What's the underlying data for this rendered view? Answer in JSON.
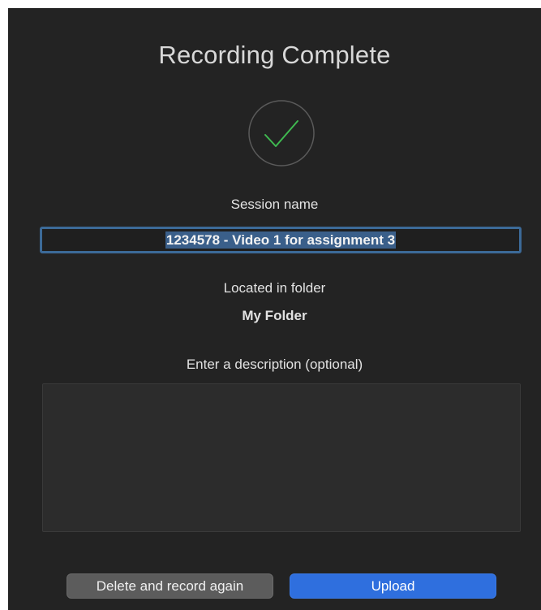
{
  "dialog": {
    "title": "Recording Complete",
    "status_icon": "checkmark-circle-icon",
    "session_name_label": "Session name",
    "session_name_value": "1234578 - Video 1 for assignment 3",
    "folder_label": "Located in folder",
    "folder_name": "My Folder",
    "description_label": "Enter a description (optional)",
    "description_value": "",
    "delete_button_label": "Delete and record again",
    "upload_button_label": "Upload"
  },
  "colors": {
    "background": "#232323",
    "check_green": "#3fb950",
    "input_focus_border": "#3c6a98",
    "upload_button": "#2f6fde",
    "delete_button": "#5c5c5c"
  }
}
